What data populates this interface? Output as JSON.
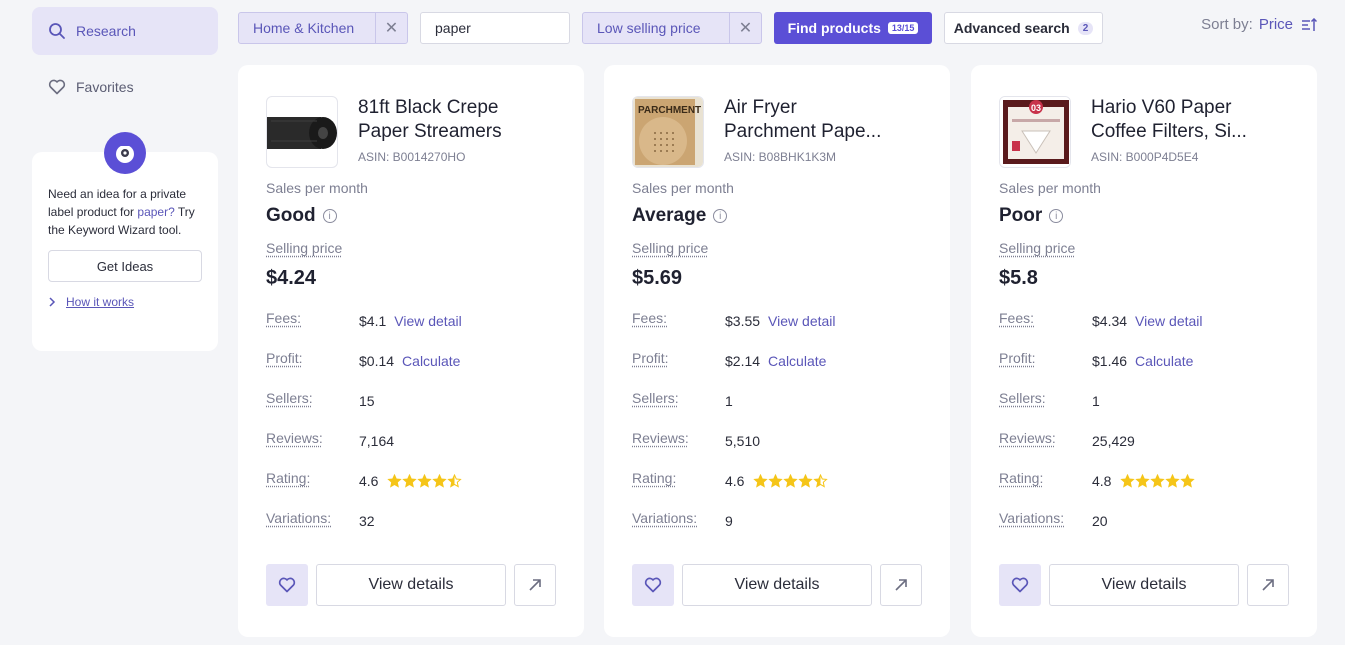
{
  "sidebar": {
    "nav": [
      {
        "label": "Research",
        "icon": "search-icon",
        "active": true
      },
      {
        "label": "Favorites",
        "icon": "heart-icon",
        "active": false
      }
    ],
    "promo": {
      "text_before": "Need an idea for a private label product for ",
      "keyword": "paper?",
      "text_after": " Try the Keyword Wizard tool.",
      "button": "Get Ideas",
      "link": "How it works"
    }
  },
  "topbar": {
    "category_chip": "Home & Kitchen",
    "search_value": "paper",
    "filter_chip": "Low selling price",
    "find_label": "Find products",
    "find_count": "13/15",
    "advanced_label": "Advanced search",
    "advanced_count": "2",
    "sort_label": "Sort by:",
    "sort_value": "Price"
  },
  "labels": {
    "sales": "Sales per month",
    "selling_price": "Selling price",
    "fees": "Fees:",
    "profit": "Profit:",
    "sellers": "Sellers:",
    "reviews": "Reviews:",
    "rating": "Rating:",
    "variations": "Variations:",
    "view_detail": "View detail",
    "calculate": "Calculate",
    "view_details": "View details",
    "info": "i"
  },
  "products": [
    {
      "title_line1": "81ft Black Crepe",
      "title_line2": "Paper Streamers",
      "asin": "ASIN: B0014270HO",
      "sales": "Good",
      "price": "$4.24",
      "fees": "$4.1",
      "profit": "$0.14",
      "sellers": "15",
      "reviews": "7,164",
      "rating": "4.6",
      "stars": 4.5
    },
    {
      "title_line1": "Air Fryer",
      "title_line2": "Parchment Pape...",
      "asin": "ASIN: B08BHK1K3M",
      "sales": "Average",
      "price": "$5.69",
      "fees": "$3.55",
      "profit": "$2.14",
      "sellers": "1",
      "reviews": "5,510",
      "rating": "4.6",
      "stars": 4.5
    },
    {
      "title_line1": "Hario V60 Paper",
      "title_line2": "Coffee Filters, Si...",
      "asin": "ASIN: B000P4D5E4",
      "sales": "Poor",
      "price": "$5.8",
      "fees": "$4.34",
      "profit": "$1.46",
      "sellers": "1",
      "reviews": "25,429",
      "rating": "4.8",
      "stars": 5
    }
  ],
  "variations": [
    "32",
    "9",
    "20"
  ],
  "thumb_text": {
    "p2": "PARCHMENT",
    "p3": "03"
  },
  "colors": {
    "accent": "#5b4fd6",
    "accent_light": "#e6e4f7",
    "star": "#f5c518",
    "link": "#5a56b8"
  }
}
